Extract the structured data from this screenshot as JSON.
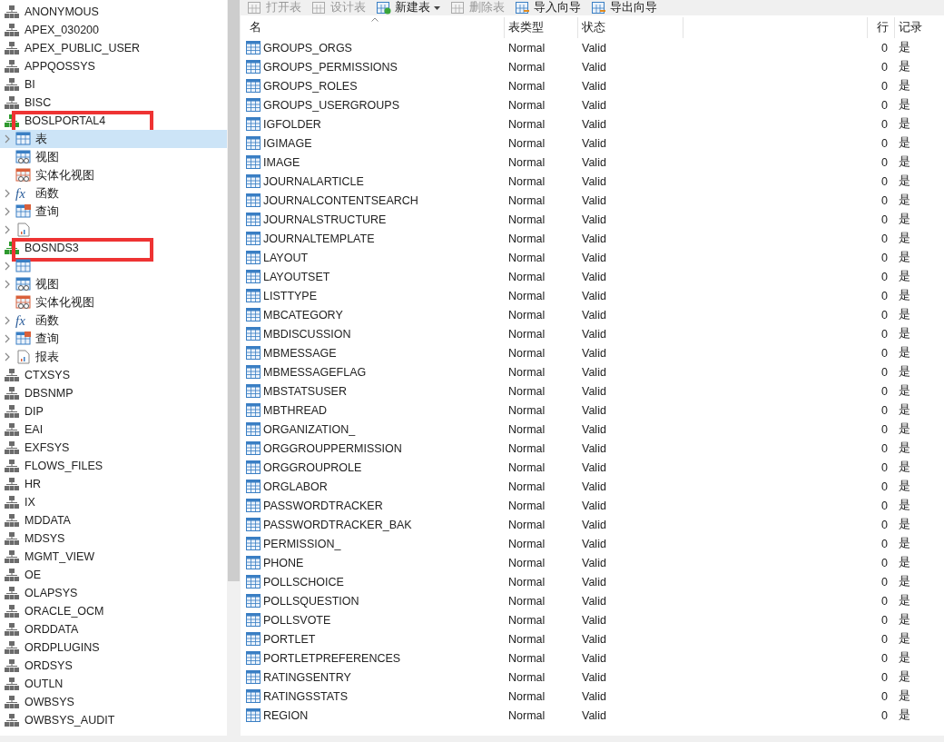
{
  "sidebar": {
    "schemas": [
      {
        "name": "ANONYMOUS",
        "expanded": false
      },
      {
        "name": "APEX_030200",
        "expanded": false
      },
      {
        "name": "APEX_PUBLIC_USER",
        "expanded": false
      },
      {
        "name": "APPQOSSYS",
        "expanded": false
      },
      {
        "name": "BI",
        "expanded": false
      },
      {
        "name": "BISC",
        "expanded": false
      },
      {
        "name": "BOSLPORTAL4",
        "expanded": true,
        "marked": true,
        "children": [
          {
            "kind": "table",
            "label": "表",
            "expandable": true,
            "selected": true
          },
          {
            "kind": "view",
            "label": "视图",
            "expandable": false,
            "selected": false
          },
          {
            "kind": "mview",
            "label": "实体化视图",
            "expandable": false,
            "selected": false
          },
          {
            "kind": "function",
            "icon": "fx",
            "label": "函数",
            "expandable": true,
            "selected": false
          },
          {
            "kind": "query",
            "label": "查询",
            "expandable": true,
            "selected": false
          },
          {
            "kind": "report",
            "expandable": true,
            "selected": false
          }
        ]
      },
      {
        "name": "BOSNDS3",
        "expanded": true,
        "marked": true,
        "children": [
          {
            "kind": "table",
            "expandable": true,
            "selected": false
          },
          {
            "kind": "view",
            "label": "视图",
            "expandable": true,
            "selected": false
          },
          {
            "kind": "mview",
            "label": "实体化视图",
            "expandable": false,
            "selected": false
          },
          {
            "kind": "function",
            "icon": "fx",
            "label": "函数",
            "expandable": true,
            "selected": false
          },
          {
            "kind": "query",
            "label": "查询",
            "expandable": true,
            "selected": false
          },
          {
            "kind": "report",
            "label": "报表",
            "expandable": true,
            "selected": false
          }
        ]
      },
      {
        "name": "CTXSYS",
        "expanded": false
      },
      {
        "name": "DBSNMP",
        "expanded": false
      },
      {
        "name": "DIP",
        "expanded": false
      },
      {
        "name": "EAI",
        "expanded": false
      },
      {
        "name": "EXFSYS",
        "expanded": false
      },
      {
        "name": "FLOWS_FILES",
        "expanded": false
      },
      {
        "name": "HR",
        "expanded": false
      },
      {
        "name": "IX",
        "expanded": false
      },
      {
        "name": "MDDATA",
        "expanded": false
      },
      {
        "name": "MDSYS",
        "expanded": false
      },
      {
        "name": "MGMT_VIEW",
        "expanded": false
      },
      {
        "name": "OE",
        "expanded": false
      },
      {
        "name": "OLAPSYS",
        "expanded": false
      },
      {
        "name": "ORACLE_OCM",
        "expanded": false
      },
      {
        "name": "ORDDATA",
        "expanded": false
      },
      {
        "name": "ORDPLUGINS",
        "expanded": false
      },
      {
        "name": "ORDSYS",
        "expanded": false
      },
      {
        "name": "OUTLN",
        "expanded": false
      },
      {
        "name": "OWBSYS",
        "expanded": false
      },
      {
        "name": "OWBSYS_AUDIT",
        "expanded": false
      }
    ]
  },
  "toolbar": [
    {
      "kind": "open",
      "label": "打开表",
      "disabled": true,
      "dropdown": false
    },
    {
      "kind": "design",
      "label": "设计表",
      "disabled": true,
      "dropdown": false
    },
    {
      "kind": "new",
      "label": "新建表",
      "disabled": false,
      "dropdown": true
    },
    {
      "kind": "delete",
      "label": "删除表",
      "disabled": true,
      "dropdown": false
    },
    {
      "kind": "import",
      "label": "导入向导",
      "disabled": false,
      "dropdown": false
    },
    {
      "kind": "export",
      "label": "导出向导",
      "disabled": false,
      "dropdown": false
    }
  ],
  "table": {
    "columns": [
      "名",
      "表类型",
      "状态",
      "行",
      "记录"
    ],
    "rows": [
      {
        "name": "GROUPS_ORGS",
        "type": "Normal",
        "status": "Valid",
        "rows": "0",
        "record": "是"
      },
      {
        "name": "GROUPS_PERMISSIONS",
        "type": "Normal",
        "status": "Valid",
        "rows": "0",
        "record": "是"
      },
      {
        "name": "GROUPS_ROLES",
        "type": "Normal",
        "status": "Valid",
        "rows": "0",
        "record": "是"
      },
      {
        "name": "GROUPS_USERGROUPS",
        "type": "Normal",
        "status": "Valid",
        "rows": "0",
        "record": "是"
      },
      {
        "name": "IGFOLDER",
        "type": "Normal",
        "status": "Valid",
        "rows": "0",
        "record": "是"
      },
      {
        "name": "IGIMAGE",
        "type": "Normal",
        "status": "Valid",
        "rows": "0",
        "record": "是"
      },
      {
        "name": "IMAGE",
        "type": "Normal",
        "status": "Valid",
        "rows": "0",
        "record": "是"
      },
      {
        "name": "JOURNALARTICLE",
        "type": "Normal",
        "status": "Valid",
        "rows": "0",
        "record": "是"
      },
      {
        "name": "JOURNALCONTENTSEARCH",
        "type": "Normal",
        "status": "Valid",
        "rows": "0",
        "record": "是"
      },
      {
        "name": "JOURNALSTRUCTURE",
        "type": "Normal",
        "status": "Valid",
        "rows": "0",
        "record": "是"
      },
      {
        "name": "JOURNALTEMPLATE",
        "type": "Normal",
        "status": "Valid",
        "rows": "0",
        "record": "是"
      },
      {
        "name": "LAYOUT",
        "type": "Normal",
        "status": "Valid",
        "rows": "0",
        "record": "是"
      },
      {
        "name": "LAYOUTSET",
        "type": "Normal",
        "status": "Valid",
        "rows": "0",
        "record": "是"
      },
      {
        "name": "LISTTYPE",
        "type": "Normal",
        "status": "Valid",
        "rows": "0",
        "record": "是"
      },
      {
        "name": "MBCATEGORY",
        "type": "Normal",
        "status": "Valid",
        "rows": "0",
        "record": "是"
      },
      {
        "name": "MBDISCUSSION",
        "type": "Normal",
        "status": "Valid",
        "rows": "0",
        "record": "是"
      },
      {
        "name": "MBMESSAGE",
        "type": "Normal",
        "status": "Valid",
        "rows": "0",
        "record": "是"
      },
      {
        "name": "MBMESSAGEFLAG",
        "type": "Normal",
        "status": "Valid",
        "rows": "0",
        "record": "是"
      },
      {
        "name": "MBSTATSUSER",
        "type": "Normal",
        "status": "Valid",
        "rows": "0",
        "record": "是"
      },
      {
        "name": "MBTHREAD",
        "type": "Normal",
        "status": "Valid",
        "rows": "0",
        "record": "是"
      },
      {
        "name": "ORGANIZATION_",
        "type": "Normal",
        "status": "Valid",
        "rows": "0",
        "record": "是"
      },
      {
        "name": "ORGGROUPPERMISSION",
        "type": "Normal",
        "status": "Valid",
        "rows": "0",
        "record": "是"
      },
      {
        "name": "ORGGROUPROLE",
        "type": "Normal",
        "status": "Valid",
        "rows": "0",
        "record": "是"
      },
      {
        "name": "ORGLABOR",
        "type": "Normal",
        "status": "Valid",
        "rows": "0",
        "record": "是"
      },
      {
        "name": "PASSWORDTRACKER",
        "type": "Normal",
        "status": "Valid",
        "rows": "0",
        "record": "是"
      },
      {
        "name": "PASSWORDTRACKER_BAK",
        "type": "Normal",
        "status": "Valid",
        "rows": "0",
        "record": "是"
      },
      {
        "name": "PERMISSION_",
        "type": "Normal",
        "status": "Valid",
        "rows": "0",
        "record": "是"
      },
      {
        "name": "PHONE",
        "type": "Normal",
        "status": "Valid",
        "rows": "0",
        "record": "是"
      },
      {
        "name": "POLLSCHOICE",
        "type": "Normal",
        "status": "Valid",
        "rows": "0",
        "record": "是"
      },
      {
        "name": "POLLSQUESTION",
        "type": "Normal",
        "status": "Valid",
        "rows": "0",
        "record": "是"
      },
      {
        "name": "POLLSVOTE",
        "type": "Normal",
        "status": "Valid",
        "rows": "0",
        "record": "是"
      },
      {
        "name": "PORTLET",
        "type": "Normal",
        "status": "Valid",
        "rows": "0",
        "record": "是"
      },
      {
        "name": "PORTLETPREFERENCES",
        "type": "Normal",
        "status": "Valid",
        "rows": "0",
        "record": "是"
      },
      {
        "name": "RATINGSENTRY",
        "type": "Normal",
        "status": "Valid",
        "rows": "0",
        "record": "是"
      },
      {
        "name": "RATINGSSTATS",
        "type": "Normal",
        "status": "Valid",
        "rows": "0",
        "record": "是"
      },
      {
        "name": "REGION",
        "type": "Normal",
        "status": "Valid",
        "rows": "0",
        "record": "是"
      }
    ]
  }
}
